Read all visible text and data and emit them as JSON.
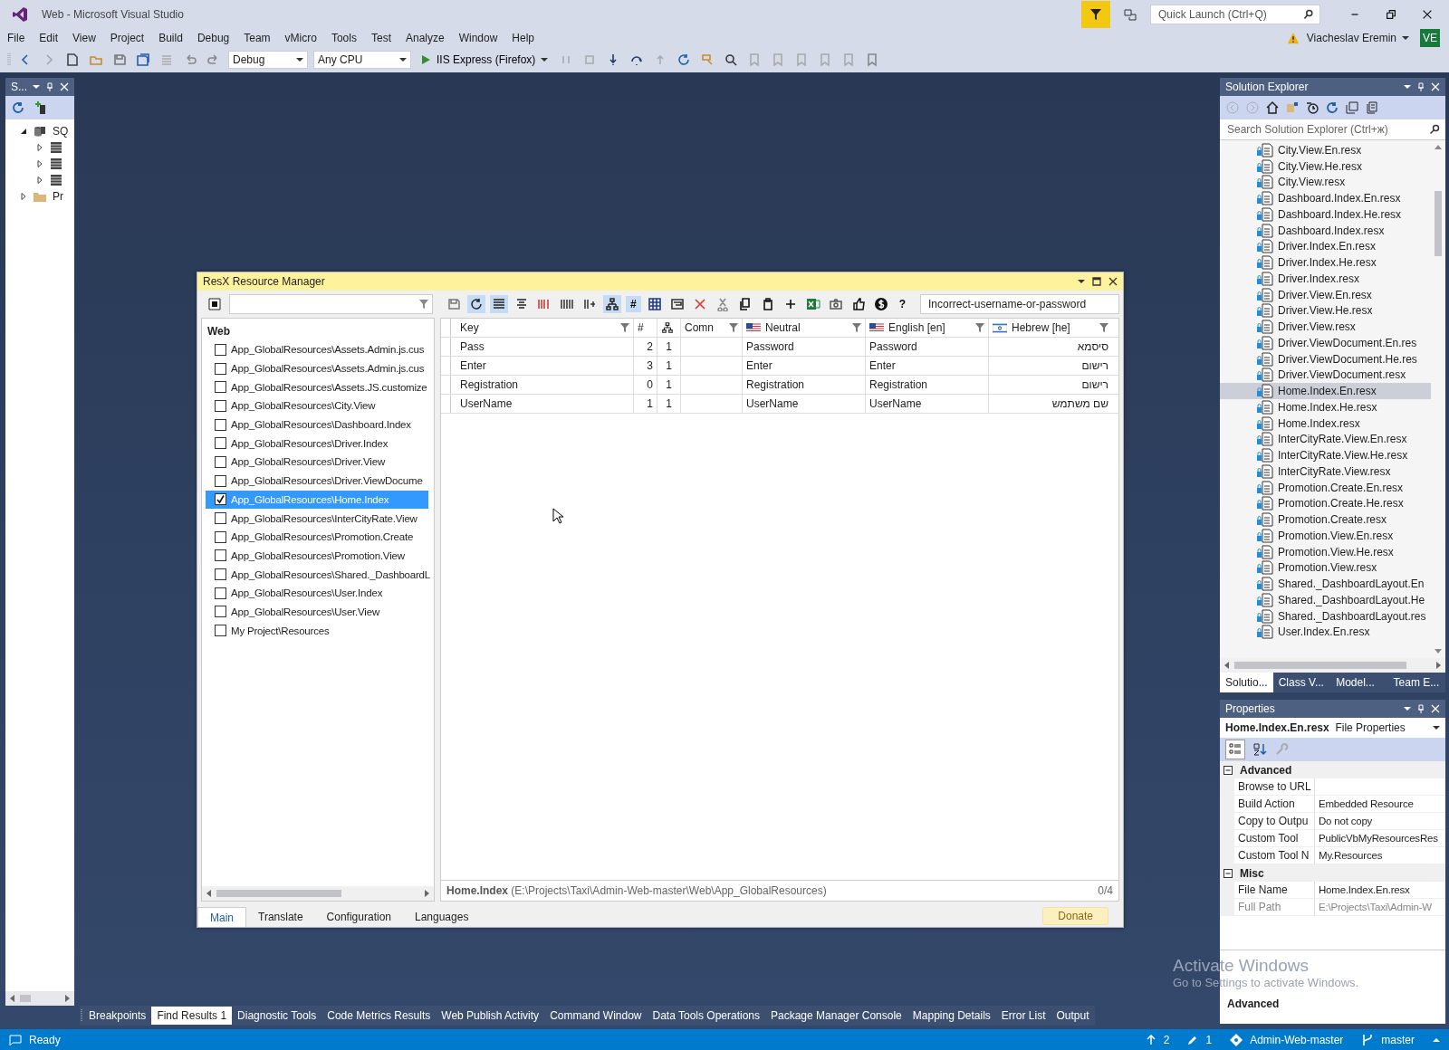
{
  "window": {
    "title": "Web - Microsoft Visual Studio"
  },
  "quick_launch": {
    "placeholder": "Quick Launch (Ctrl+Q)"
  },
  "user": {
    "name": "Viacheslav Eremin",
    "initials": "VE"
  },
  "menu": [
    "File",
    "Edit",
    "View",
    "Project",
    "Build",
    "Debug",
    "Team",
    "vMicro",
    "Tools",
    "Test",
    "Analyze",
    "Window",
    "Help"
  ],
  "toolbar": {
    "configuration": "Debug",
    "platform": "Any CPU",
    "run_target": "IIS Express (Firefox)"
  },
  "server_explorer": {
    "title": "S...",
    "tree": [
      {
        "label": "SQ",
        "expanded": true,
        "children": [
          {
            "expanded": false
          },
          {
            "expanded": false
          },
          {
            "expanded": false
          }
        ]
      },
      {
        "label": "Pr",
        "expanded": false
      }
    ]
  },
  "resx": {
    "title": "ResX Resource Manager",
    "search_text": "Incorrect-username-or-password",
    "hash_button": "#",
    "help_button": "?",
    "project": "Web",
    "files": [
      {
        "label": "App_GlobalResources\\Assets.Admin.js.cus",
        "checked": false,
        "selected": false
      },
      {
        "label": "App_GlobalResources\\Assets.Admin.js.cus",
        "checked": false,
        "selected": false
      },
      {
        "label": "App_GlobalResources\\Assets.JS.customize",
        "checked": false,
        "selected": false
      },
      {
        "label": "App_GlobalResources\\City.View",
        "checked": false,
        "selected": false
      },
      {
        "label": "App_GlobalResources\\Dashboard.Index",
        "checked": false,
        "selected": false
      },
      {
        "label": "App_GlobalResources\\Driver.Index",
        "checked": false,
        "selected": false
      },
      {
        "label": "App_GlobalResources\\Driver.View",
        "checked": false,
        "selected": false
      },
      {
        "label": "App_GlobalResources\\Driver.ViewDocume",
        "checked": false,
        "selected": false
      },
      {
        "label": "App_GlobalResources\\Home.Index",
        "checked": true,
        "selected": true
      },
      {
        "label": "App_GlobalResources\\InterCityRate.View",
        "checked": false,
        "selected": false
      },
      {
        "label": "App_GlobalResources\\Promotion.Create",
        "checked": false,
        "selected": false
      },
      {
        "label": "App_GlobalResources\\Promotion.View",
        "checked": false,
        "selected": false
      },
      {
        "label": "App_GlobalResources\\Shared._DashboardL",
        "checked": false,
        "selected": false
      },
      {
        "label": "App_GlobalResources\\User.Index",
        "checked": false,
        "selected": false
      },
      {
        "label": "App_GlobalResources\\User.View",
        "checked": false,
        "selected": false
      },
      {
        "label": "My Project\\Resources",
        "checked": false,
        "selected": false
      }
    ],
    "columns": [
      {
        "kind": "key",
        "label": "Key"
      },
      {
        "kind": "count",
        "label": "#"
      },
      {
        "kind": "tree"
      },
      {
        "kind": "comment",
        "label": "Comn"
      },
      {
        "kind": "neutral",
        "label": "Neutral"
      },
      {
        "kind": "english",
        "label": "English [en]"
      },
      {
        "kind": "hebrew",
        "label": "Hebrew [he]"
      }
    ],
    "rows": [
      {
        "key": "Pass",
        "count": "2",
        "column_3": "1",
        "neutral": "Password",
        "english": "Password",
        "hebrew": "סיסמא"
      },
      {
        "key": "Enter",
        "count": "3",
        "column_3": "1",
        "neutral": "Enter",
        "english": "Enter",
        "hebrew": "רישום"
      },
      {
        "key": "Registration",
        "count": "0",
        "column_3": "1",
        "neutral": "Registration",
        "english": "Registration",
        "hebrew": "רישום"
      },
      {
        "key": "UserName",
        "count": "1",
        "column_3": "1",
        "neutral": "UserName",
        "english": "UserName",
        "hebrew": "שם משתמש"
      }
    ],
    "status": {
      "name": "Home.Index",
      "path": "(E:\\Projects\\Taxi\\Admin-Web-master\\Web\\App_GlobalResources)",
      "count": "0/4"
    },
    "tabs": [
      {
        "label": "Main",
        "selected": true
      },
      {
        "label": "Translate",
        "selected": false
      },
      {
        "label": "Configuration",
        "selected": false
      },
      {
        "label": "Languages",
        "selected": false
      }
    ],
    "donate": "Donate"
  },
  "solution_explorer": {
    "title": "Solution Explorer",
    "search_placeholder": "Search Solution Explorer (Ctrl+ж)",
    "items": [
      {
        "label": "City.View.En.resx",
        "selected": false
      },
      {
        "label": "City.View.He.resx",
        "selected": false
      },
      {
        "label": "City.View.resx",
        "selected": false
      },
      {
        "label": "Dashboard.Index.En.resx",
        "selected": false
      },
      {
        "label": "Dashboard.Index.He.resx",
        "selected": false
      },
      {
        "label": "Dashboard.Index.resx",
        "selected": false
      },
      {
        "label": "Driver.Index.En.resx",
        "selected": false
      },
      {
        "label": "Driver.Index.He.resx",
        "selected": false
      },
      {
        "label": "Driver.Index.resx",
        "selected": false
      },
      {
        "label": "Driver.View.En.resx",
        "selected": false
      },
      {
        "label": "Driver.View.He.resx",
        "selected": false
      },
      {
        "label": "Driver.View.resx",
        "selected": false
      },
      {
        "label": "Driver.ViewDocument.En.res",
        "selected": false
      },
      {
        "label": "Driver.ViewDocument.He.res",
        "selected": false
      },
      {
        "label": "Driver.ViewDocument.resx",
        "selected": false
      },
      {
        "label": "Home.Index.En.resx",
        "selected": true
      },
      {
        "label": "Home.Index.He.resx",
        "selected": false
      },
      {
        "label": "Home.Index.resx",
        "selected": false
      },
      {
        "label": "InterCityRate.View.En.resx",
        "selected": false
      },
      {
        "label": "InterCityRate.View.He.resx",
        "selected": false
      },
      {
        "label": "InterCityRate.View.resx",
        "selected": false
      },
      {
        "label": "Promotion.Create.En.resx",
        "selected": false
      },
      {
        "label": "Promotion.Create.He.resx",
        "selected": false
      },
      {
        "label": "Promotion.Create.resx",
        "selected": false
      },
      {
        "label": "Promotion.View.En.resx",
        "selected": false
      },
      {
        "label": "Promotion.View.He.resx",
        "selected": false
      },
      {
        "label": "Promotion.View.resx",
        "selected": false
      },
      {
        "label": "Shared._DashboardLayout.En",
        "selected": false
      },
      {
        "label": "Shared._DashboardLayout.He",
        "selected": false
      },
      {
        "label": "Shared._DashboardLayout.res",
        "selected": false
      },
      {
        "label": "User.Index.En.resx",
        "selected": false
      }
    ],
    "tabs": [
      {
        "label": "Solutio...",
        "selected": true
      },
      {
        "label": "Class V...",
        "selected": false
      },
      {
        "label": "Model...",
        "selected": false
      },
      {
        "label": "Team E...",
        "selected": false
      }
    ]
  },
  "properties": {
    "title": "Properties",
    "object_name": "Home.Index.En.resx",
    "object_type": "File Properties",
    "categories": [
      {
        "label": "Advanced",
        "expanded": true,
        "rows": [
          {
            "name": "Browse to URL",
            "disabled": false
          },
          {
            "name": "Build Action",
            "value": "Embedded Resource",
            "disabled": false
          },
          {
            "name": "Copy to Outpu",
            "value": "Do not copy",
            "disabled": false
          },
          {
            "name": "Custom Tool",
            "value": "PublicVbMyResourcesRes",
            "disabled": false
          },
          {
            "name": "Custom Tool N",
            "value": "My.Resources",
            "disabled": false
          }
        ]
      },
      {
        "label": "Misc",
        "expanded": true,
        "rows": [
          {
            "name": "File Name",
            "value": "Home.Index.En.resx",
            "disabled": false
          },
          {
            "name": "Full Path",
            "value": "E:\\Projects\\Taxi\\Admin-W",
            "disabled": true
          }
        ]
      }
    ],
    "description": "Advanced"
  },
  "bottom_tabs": [
    {
      "label": "Breakpoints",
      "selected": false
    },
    {
      "label": "Find Results 1",
      "selected": true
    },
    {
      "label": "Diagnostic Tools",
      "selected": false
    },
    {
      "label": "Code Metrics Results",
      "selected": false
    },
    {
      "label": "Web Publish Activity",
      "selected": false
    },
    {
      "label": "Command Window",
      "selected": false
    },
    {
      "label": "Data Tools Operations",
      "selected": false
    },
    {
      "label": "Package Manager Console",
      "selected": false
    },
    {
      "label": "Mapping Details",
      "selected": false
    },
    {
      "label": "Error List",
      "selected": false
    },
    {
      "label": "Output",
      "selected": false
    }
  ],
  "status_bar": {
    "text": "Ready",
    "pushes": "2",
    "changes": "1",
    "repository": "Admin-Web-master",
    "branch": "master"
  },
  "activation": {
    "title": "Activate Windows",
    "hint": "Go to Settings to activate Windows."
  }
}
